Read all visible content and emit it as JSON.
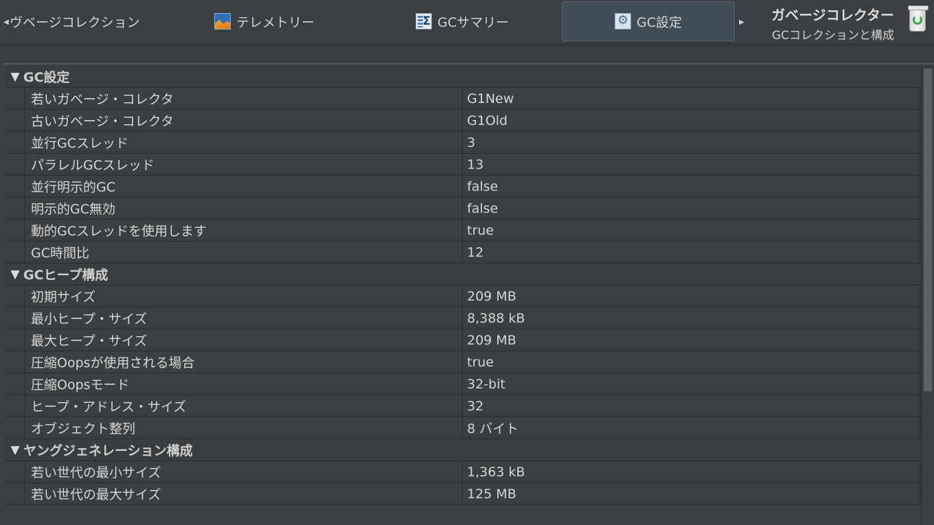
{
  "tabs": {
    "first_label": "ヴベージコレクション",
    "telemetry_label": "テレメトリー",
    "summary_label": "GCサマリー",
    "settings_label": "GC設定",
    "summary_sigma": "Σ"
  },
  "nav": {
    "left_arrow": "◀",
    "right_arrow": "▶"
  },
  "panel": {
    "title": "ガベージコレクター",
    "subtitle": "GCコレクションと構成"
  },
  "sections": [
    {
      "title": "GC設定",
      "rows": [
        {
          "key": "若いガベージ・コレクタ",
          "value": "G1New"
        },
        {
          "key": "古いガベージ・コレクタ",
          "value": "G1Old"
        },
        {
          "key": "並行GCスレッド",
          "value": "3"
        },
        {
          "key": "パラレルGCスレッド",
          "value": "13"
        },
        {
          "key": "並行明示的GC",
          "value": "false"
        },
        {
          "key": "明示的GC無効",
          "value": "false"
        },
        {
          "key": "動的GCスレッドを使用します",
          "value": "true"
        },
        {
          "key": "GC時間比",
          "value": "12"
        }
      ]
    },
    {
      "title": "GCヒープ構成",
      "rows": [
        {
          "key": "初期サイズ",
          "value": "209 MB"
        },
        {
          "key": "最小ヒープ・サイズ",
          "value": "8,388 kB"
        },
        {
          "key": "最大ヒープ・サイズ",
          "value": "209 MB"
        },
        {
          "key": "圧縮Oopsが使用される場合",
          "value": "true"
        },
        {
          "key": "圧縮Oopsモード",
          "value": "32-bit"
        },
        {
          "key": "ヒープ・アドレス・サイズ",
          "value": "32"
        },
        {
          "key": "オブジェクト整列",
          "value": "8 バイト"
        }
      ]
    },
    {
      "title": "ヤングジェネレーション構成",
      "rows": [
        {
          "key": "若い世代の最小サイズ",
          "value": "1,363 kB"
        },
        {
          "key": "若い世代の最大サイズ",
          "value": "125 MB"
        }
      ]
    }
  ],
  "section_toggle": "▼",
  "icons": {
    "telemetry": "telemetry-chart-icon",
    "summary": "gc-summary-icon",
    "settings": "gc-settings-icon",
    "trash": "garbage-collector-trash-icon"
  },
  "colors": {
    "background": "#3c3f41",
    "selected_tab": "#404c58",
    "text": "#d6d6d6"
  }
}
